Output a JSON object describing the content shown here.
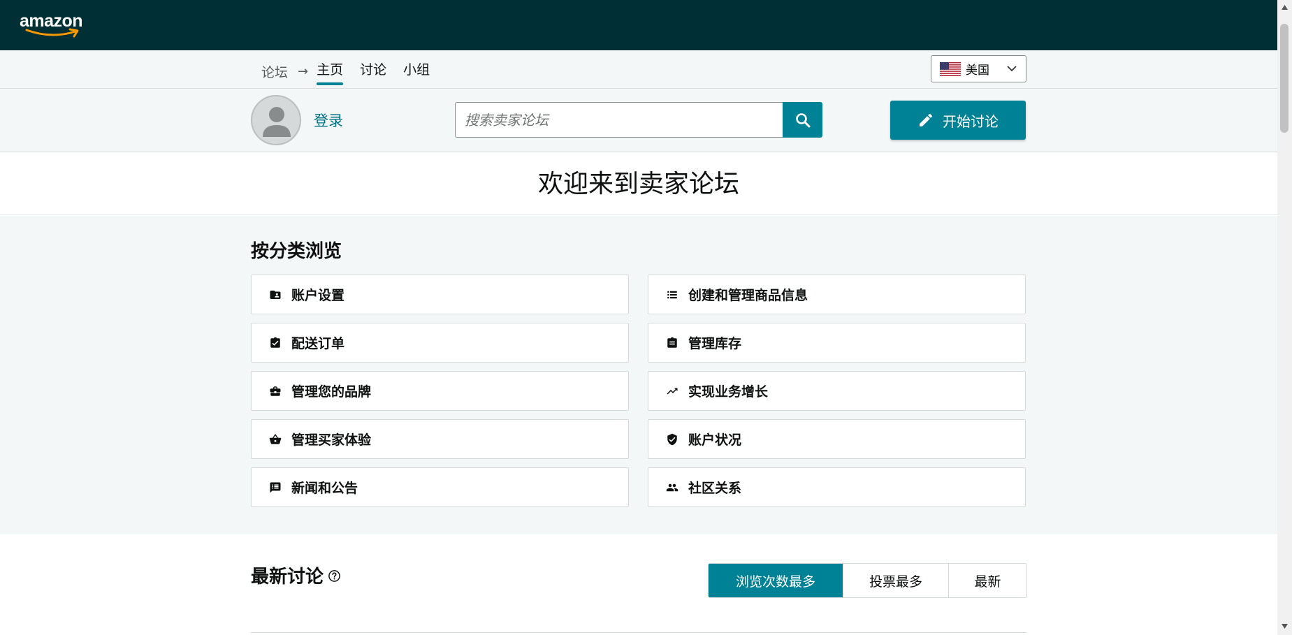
{
  "header": {
    "logo_text": "amazon"
  },
  "nav": {
    "forum": "论坛",
    "tabs": [
      {
        "label": "主页",
        "active": true
      },
      {
        "label": "讨论",
        "active": false
      },
      {
        "label": "小组",
        "active": false
      }
    ],
    "country": "美国"
  },
  "user": {
    "login": "登录",
    "search_placeholder": "搜索卖家论坛",
    "start_discussion": "开始讨论"
  },
  "welcome": {
    "title": "欢迎来到卖家论坛"
  },
  "browse": {
    "title": "按分类浏览",
    "categories": [
      {
        "label": "账户设置",
        "icon": "account-folder-icon"
      },
      {
        "label": "创建和管理商品信息",
        "icon": "list-icon"
      },
      {
        "label": "配送订单",
        "icon": "clipboard-check-icon"
      },
      {
        "label": "管理库存",
        "icon": "inventory-icon"
      },
      {
        "label": "管理您的品牌",
        "icon": "briefcase-icon"
      },
      {
        "label": "实现业务增长",
        "icon": "trending-up-icon"
      },
      {
        "label": "管理买家体验",
        "icon": "basket-icon"
      },
      {
        "label": "账户状况",
        "icon": "shield-check-icon"
      },
      {
        "label": "新闻和公告",
        "icon": "announcement-icon"
      },
      {
        "label": "社区关系",
        "icon": "people-icon"
      }
    ]
  },
  "latest": {
    "title": "最新讨论",
    "sort_options": [
      {
        "label": "浏览次数最多",
        "active": true
      },
      {
        "label": "投票最多",
        "active": false
      },
      {
        "label": "最新",
        "active": false
      }
    ]
  },
  "colors": {
    "header_bg": "#002f36",
    "accent": "#008296",
    "link": "#007185",
    "section_bg": "#f3f7f8"
  }
}
